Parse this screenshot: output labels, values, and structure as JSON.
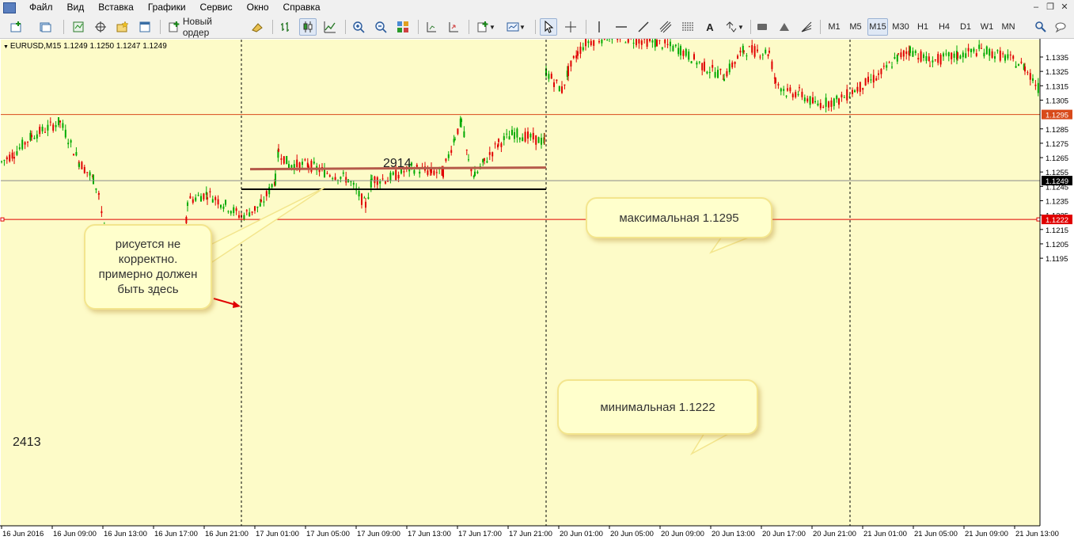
{
  "menu": {
    "items": [
      "Файл",
      "Вид",
      "Вставка",
      "Графики",
      "Сервис",
      "Окно",
      "Справка"
    ],
    "window_controls": [
      "–",
      "❐",
      "✕"
    ]
  },
  "toolbar": {
    "new_order_label": "Новый ордер",
    "timeframes": [
      "M1",
      "M5",
      "M15",
      "M30",
      "H1",
      "H4",
      "D1",
      "W1",
      "MN"
    ],
    "active_timeframe": "M15"
  },
  "chart": {
    "symbol_line": "EURUSD,M15  1.1249 1.1250 1.1247 1.1249",
    "colors": {
      "background": "#fdfbc8",
      "bull": "#00aa00",
      "bear": "#e00000",
      "grid": "#000000",
      "max_line": "#d84a1a",
      "min_line": "#e00000",
      "bid_line": "#8a8a8a",
      "hl_box_line": "#000000",
      "wrong_line": "#b55a4a",
      "arrow": "#e00000"
    },
    "price_labels": [
      "1.1335",
      "1.1325",
      "1.1315",
      "1.1305",
      "1.1295",
      "1.1285",
      "1.1275",
      "1.1265",
      "1.1255",
      "1.1249",
      "1.1245",
      "1.1235",
      "1.1225",
      "1.1222",
      "1.1215",
      "1.1205",
      "1.1195"
    ],
    "price_levels": {
      "max": 1.1295,
      "min": 1.1222,
      "bid": 1.1249,
      "drawn_line": 1.1257
    },
    "time_labels": [
      "16 Jun 2016",
      "16 Jun 09:00",
      "16 Jun 13:00",
      "16 Jun 17:00",
      "16 Jun 21:00",
      "17 Jun 01:00",
      "17 Jun 05:00",
      "17 Jun 09:00",
      "17 Jun 13:00",
      "17 Jun 17:00",
      "17 Jun 21:00",
      "20 Jun 01:00",
      "20 Jun 05:00",
      "20 Jun 09:00",
      "20 Jun 13:00",
      "20 Jun 17:00",
      "20 Jun 21:00",
      "21 Jun 01:00",
      "21 Jun 05:00",
      "21 Jun 09:00",
      "21 Jun 13:00"
    ],
    "bar_count_right": "2914",
    "bar_count_left": "2413",
    "annotations": {
      "wrong_note": "рисуется не корректно. примерно должен быть здесь",
      "max_note": "максимальная 1.1295",
      "min_note": "минимальная 1.1222"
    }
  }
}
